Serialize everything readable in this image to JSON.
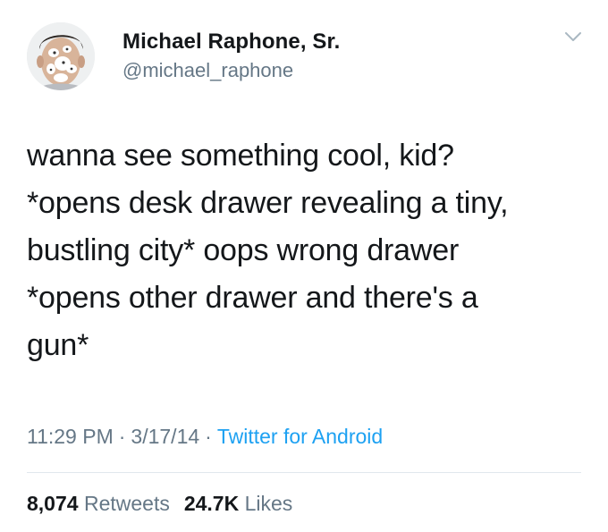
{
  "user": {
    "display_name": "Michael Raphone, Sr.",
    "handle": "@michael_raphone",
    "avatar_icon": "profile-photo"
  },
  "menu": {
    "icon": "chevron-down-icon"
  },
  "tweet": {
    "text": "wanna see something cool, kid?\n*opens desk drawer revealing a tiny,\nbustling city* oops wrong drawer\n*opens other drawer and there's a\ngun*"
  },
  "meta": {
    "time": "11:29 PM",
    "separator": "·",
    "date": "3/17/14",
    "source": "Twitter for Android"
  },
  "stats": {
    "retweets_count": "8,074",
    "retweets_label": "Retweets",
    "likes_count": "24.7K",
    "likes_label": "Likes"
  },
  "colors": {
    "text": "#14171a",
    "secondary": "#657786",
    "link": "#1da1f2",
    "divider": "#e1e8ed"
  }
}
